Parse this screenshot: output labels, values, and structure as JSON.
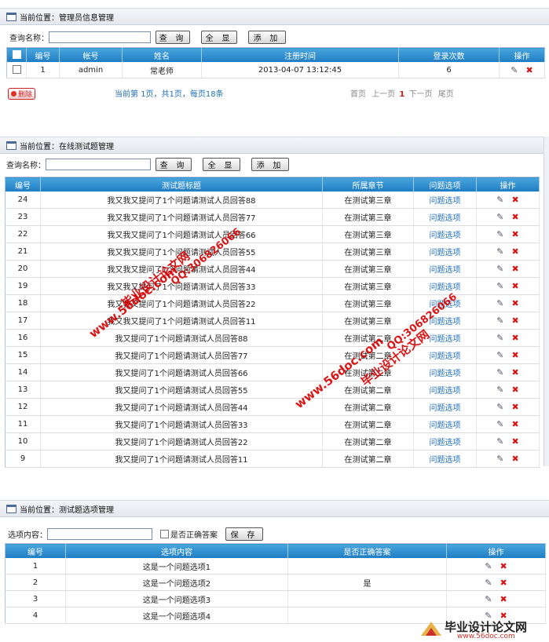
{
  "panel1": {
    "crumb": "当前位置：管理员信息管理",
    "search_label": "查询名称：",
    "btn_query": "查 询",
    "btn_all": "全 显",
    "btn_add": "添 加",
    "headers": [
      "编号",
      "帐号",
      "姓名",
      "注册时间",
      "登录次数",
      "操作"
    ],
    "rows": [
      [
        "1",
        "admin",
        "常老师",
        "2013-04-07 13:12:45",
        "6"
      ]
    ],
    "delete_label": "删除",
    "pager_info_1": "当前第",
    "pager_info_2": "1页，共1页，每页18条",
    "pager_first": "首页",
    "pager_prev": "上一页",
    "pager_cur": "1",
    "pager_next": "下一页",
    "pager_last": "尾页"
  },
  "panel2": {
    "crumb": "当前位置：在线测试题管理",
    "search_label": "查询名称：",
    "btn_query": "查 询",
    "btn_all": "全 显",
    "btn_add": "添 加",
    "headers": [
      "编号",
      "测试题标题",
      "所属章节",
      "问题选项",
      "操作"
    ],
    "rows": [
      [
        "24",
        "我又我又提问了1个问题请测试人员回答88",
        "在测试第三章",
        "问题选项"
      ],
      [
        "23",
        "我又我又提问了1个问题请测试人员回答77",
        "在测试第三章",
        "问题选项"
      ],
      [
        "22",
        "我又我又提问了1个问题请测试人员回答66",
        "在测试第三章",
        "问题选项"
      ],
      [
        "21",
        "我又我又提问了1个问题请测试人员回答55",
        "在测试第三章",
        "问题选项"
      ],
      [
        "20",
        "我又我又提问了1个问题请测试人员回答44",
        "在测试第三章",
        "问题选项"
      ],
      [
        "19",
        "我又我又提问了1个问题请测试人员回答33",
        "在测试第三章",
        "问题选项"
      ],
      [
        "18",
        "我又我又提问了1个问题请测试人员回答22",
        "在测试第三章",
        "问题选项"
      ],
      [
        "17",
        "我又我又提问了1个问题请测试人员回答11",
        "在测试第三章",
        "问题选项"
      ],
      [
        "16",
        "我又提问了1个问题请测试人员回答88",
        "在测试第二章",
        "问题选项"
      ],
      [
        "15",
        "我又提问了1个问题请测试人员回答77",
        "在测试第二章",
        "问题选项"
      ],
      [
        "14",
        "我又提问了1个问题请测试人员回答66",
        "在测试第二章",
        "问题选项"
      ],
      [
        "13",
        "我又提问了1个问题请测试人员回答55",
        "在测试第二章",
        "问题选项"
      ],
      [
        "12",
        "我又提问了1个问题请测试人员回答44",
        "在测试第二章",
        "问题选项"
      ],
      [
        "11",
        "我又提问了1个问题请测试人员回答33",
        "在测试第二章",
        "问题选项"
      ],
      [
        "10",
        "我又提问了1个问题请测试人员回答22",
        "在测试第二章",
        "问题选项"
      ],
      [
        "9",
        "我又提问了1个问题请测试人员回答11",
        "在测试第二章",
        "问题选项"
      ]
    ]
  },
  "panel3": {
    "crumb": "当前位置：测试题选项管理",
    "option_label": "选项内容：",
    "correct_label": "是否正确答案",
    "btn_save": "保 存",
    "headers": [
      "编号",
      "选项内容",
      "是否正确答案",
      "操作"
    ],
    "rows": [
      [
        "1",
        "这是一个问题选项1",
        ""
      ],
      [
        "2",
        "这是一个问题选项2",
        "是"
      ],
      [
        "3",
        "这是一个问题选项3",
        ""
      ],
      [
        "4",
        "这是一个问题选项4",
        ""
      ]
    ]
  },
  "watermarks": {
    "site": "www.56doc.com",
    "qq": "QQ:306826066",
    "title": "毕业设计论文网"
  },
  "corner_logo": {
    "title": "毕业设计论文网",
    "url": "www.56doc.com"
  },
  "icons": {
    "edit": "pencil-icon",
    "delete": "close-icon"
  },
  "colors": {
    "header_blue": "#1f7cc2",
    "link_blue": "#1f6fb8",
    "delete_red": "#d41818",
    "watermark_red": "#d40000"
  }
}
